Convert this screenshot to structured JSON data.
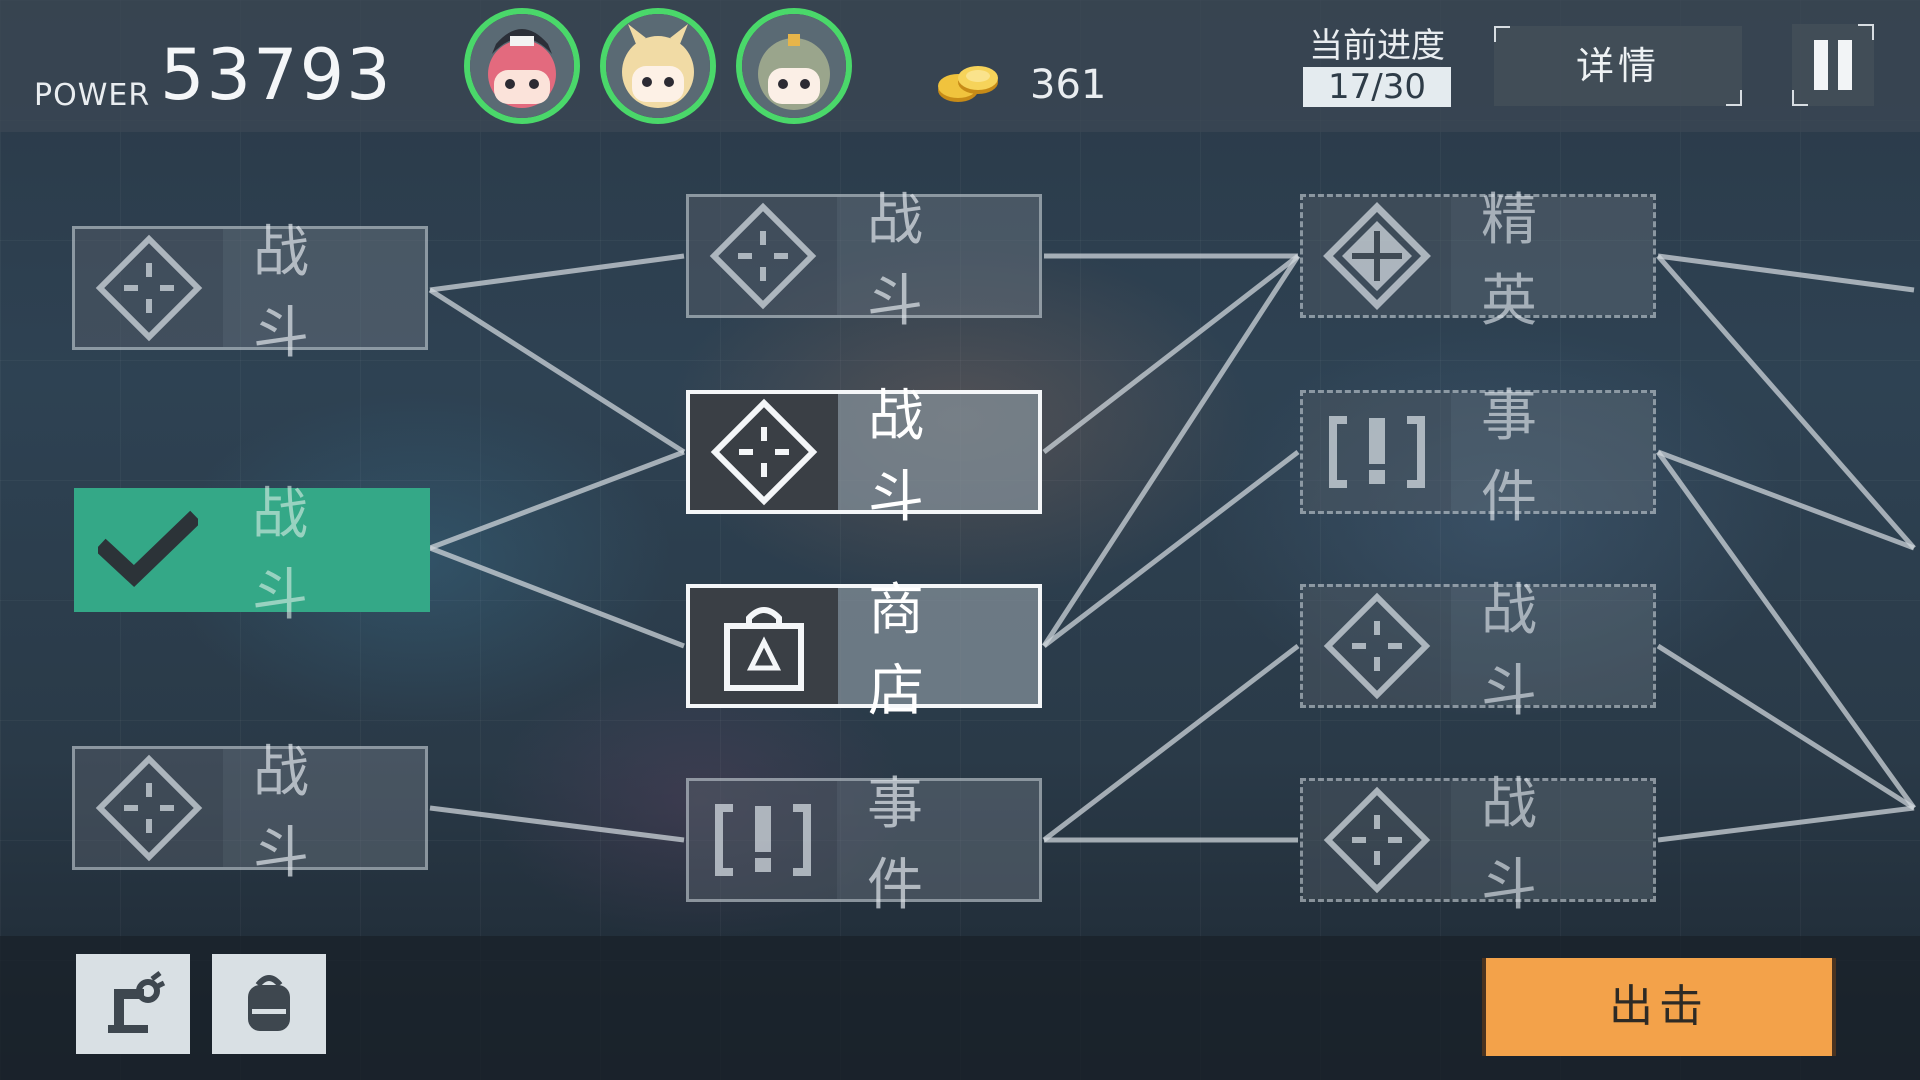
{
  "hud": {
    "power_label": "POWER",
    "power_value": "53793",
    "coins": "361",
    "progress_label": "当前进度",
    "progress_value": "17/30",
    "detail_label": "详情"
  },
  "team": [
    {
      "name": "avatar-red-hair",
      "ring_color": "#4ad86a"
    },
    {
      "name": "avatar-blonde",
      "ring_color": "#4ad86a"
    },
    {
      "name": "avatar-green-hair",
      "ring_color": "#4ad86a"
    }
  ],
  "route_nodes": [
    {
      "id": "c1r1",
      "label": "战 斗",
      "type": "battle",
      "icon": "crosshair-diamond-icon",
      "state": "dim"
    },
    {
      "id": "c1r2",
      "label": "战 斗",
      "type": "battle",
      "icon": "checkmark-icon",
      "state": "done"
    },
    {
      "id": "c1r3",
      "label": "战 斗",
      "type": "battle",
      "icon": "crosshair-diamond-icon",
      "state": "dim"
    },
    {
      "id": "c2r1",
      "label": "战 斗",
      "type": "battle",
      "icon": "crosshair-diamond-icon",
      "state": "dim"
    },
    {
      "id": "c2r2",
      "label": "战 斗",
      "type": "battle",
      "icon": "crosshair-diamond-icon",
      "state": "active"
    },
    {
      "id": "c2r3",
      "label": "商 店",
      "type": "shop",
      "icon": "shopping-bag-icon",
      "state": "active"
    },
    {
      "id": "c2r4",
      "label": "事 件",
      "type": "event",
      "icon": "exclamation-bracket-icon",
      "state": "dim"
    },
    {
      "id": "c3r1",
      "label": "精 英",
      "type": "elite",
      "icon": "elite-diamond-icon",
      "state": "dashed"
    },
    {
      "id": "c3r2",
      "label": "事 件",
      "type": "event",
      "icon": "exclamation-bracket-icon",
      "state": "dashed"
    },
    {
      "id": "c3r3",
      "label": "战 斗",
      "type": "battle",
      "icon": "crosshair-diamond-icon",
      "state": "dashed"
    },
    {
      "id": "c3r4",
      "label": "战 斗",
      "type": "battle",
      "icon": "crosshair-diamond-icon",
      "state": "dashed"
    }
  ],
  "toolbar": {
    "tool1_icon": "robot-arm-icon",
    "tool2_icon": "backpack-icon",
    "sortie_label": "出击"
  },
  "colors": {
    "done": "#34a887",
    "sortie": "#f3a24a",
    "team_ring": "#4ad86a"
  }
}
